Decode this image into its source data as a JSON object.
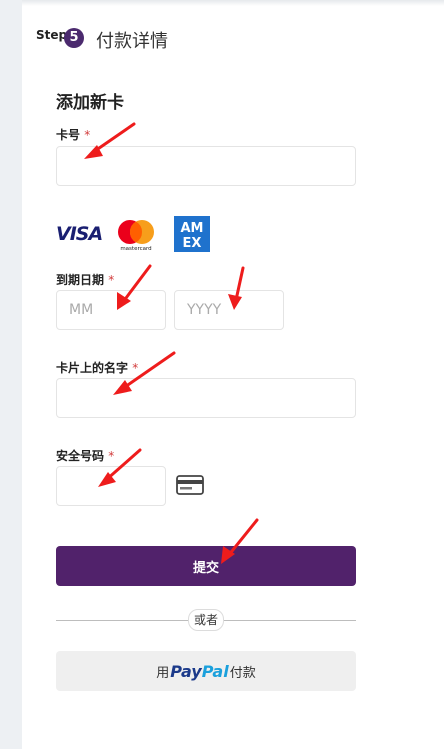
{
  "step": {
    "word": "Step",
    "number": "5",
    "title": "付款详情"
  },
  "form": {
    "section_title": "添加新卡",
    "card_number": {
      "label": "卡号",
      "required_mark": "*",
      "value": "",
      "placeholder": ""
    },
    "card_brands": {
      "visa": "VISA",
      "mastercard": "mastercard",
      "amex_top": "AM",
      "amex_bottom": "EX"
    },
    "expiry": {
      "label": "到期日期",
      "required_mark": "*",
      "month_placeholder": "MM",
      "year_placeholder": "YYYY"
    },
    "name_on_card": {
      "label": "卡片上的名字",
      "required_mark": "*",
      "value": "",
      "placeholder": ""
    },
    "security_code": {
      "label": "安全号码",
      "required_mark": "*",
      "value": "",
      "placeholder": ""
    },
    "submit_label": "提交",
    "or_label": "或者",
    "paypal": {
      "prefix": "用",
      "logo_part1": "Pay",
      "logo_part2": "Pal",
      "suffix": "付款"
    }
  },
  "colors": {
    "accent": "#51226b",
    "step_badge": "#4b2a6e",
    "required": "#d23b3b",
    "annotation_arrow": "#ee1c1c",
    "paypal_dark": "#1b3a8a",
    "paypal_light": "#1aa0dc"
  },
  "icons": [
    "visa-logo",
    "mastercard-logo",
    "amex-logo",
    "cvv-card-icon",
    "annotation-arrow"
  ]
}
